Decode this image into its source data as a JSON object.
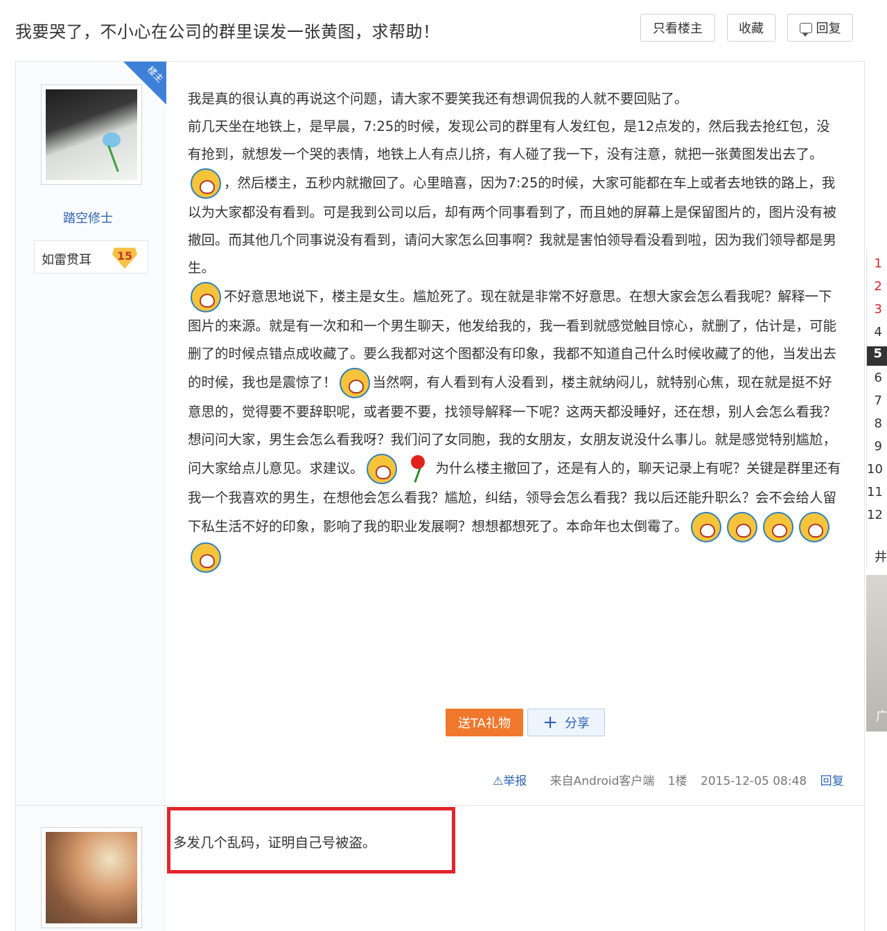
{
  "header": {
    "title": "我要哭了，不小心在公司的群里误发一张黄图，求帮助！",
    "btn_only_op": "只看楼主",
    "btn_favorite": "收藏",
    "btn_reply": "回复"
  },
  "post1": {
    "ribbon": "楼主",
    "username": "踏空修士",
    "level_name": "如雷贯耳",
    "level_num": "15",
    "paragraphs": [
      "我是真的很认真的再说这个问题，请大家不要笑我还有想调侃我的人就不要回贴了。",
      "前几天坐在地铁上，是早晨，7:25的时候，发现公司的群里有人发红包，是12点发的，然后我去抢红包，没有抢到，就想发一个哭的表情，地铁上人有点儿挤，有人碰了我一下，没有注意，就把一张黄图发出去了。",
      "，然后楼主，五秒内就撤回了。心里暗喜，因为7:25的时候，大家可能都在车上或者去地铁的路上，我以为大家都没有看到。可是我到公司以后，却有两个同事看到了，而且她的屏幕上是保留图片的，图片没有被撤回。而其他几个同事说没有看到，请问大家怎么回事啊？我就是害怕领导看没看到啦，因为我们领导都是男生。",
      "不好意思地说下，楼主是女生。尴尬死了。现在就是非常不好意思。在想大家会怎么看我呢？解释一下图片的来源。就是有一次和和一个男生聊天，他发给我的，我一看到就感觉触目惊心，就删了，估计是，可能删了的时候点错点成收藏了。要么我都对这个图都没有印象，我都不知道自己什么时候收藏了的他，当发出去的时候，我也是震惊了！",
      "当然啊，有人看到有人没看到，楼主就纳闷儿，就特别心焦，现在就是挺不好意思的，觉得要不要辞职呢，或者要不要，找领导解释一下呢？这两天都没睡好，还在想，别人会怎么看我？想问问大家，男生会怎么看我呀？我们问了女同胞，我的女朋友，女朋友说没什么事儿。就是感觉特别尴尬，问大家给点儿意见。求建议。",
      "为什么楼主撤回了，还是有人的，聊天记录上有呢？关键是群里还有我一个我喜欢的男生，在想他会怎么看我？尴尬，纠结，领导会怎么看我？我以后还能升职么？会不会给人留下私生活不好的印象，影响了我的职业发展啊？想想都想死了。本命年也太倒霉了。"
    ],
    "gift_btn": "送TA礼物",
    "share_btn": "分享",
    "report": "举报",
    "source": "来自Android客户端",
    "floor": "1楼",
    "time": "2015-12-05 08:48",
    "reply": "回复"
  },
  "post2": {
    "text": "多发几个乱码，证明自己号被盗。"
  },
  "pager": [
    "1",
    "2",
    "3",
    "4",
    "5",
    "6",
    "7",
    "8",
    "9",
    "10",
    "11",
    "12"
  ],
  "side": {
    "char1": "井",
    "char2": "广"
  },
  "colors": {
    "link": "#2d64b3",
    "orange": "#f0782d",
    "highlight": "#e2262b"
  }
}
